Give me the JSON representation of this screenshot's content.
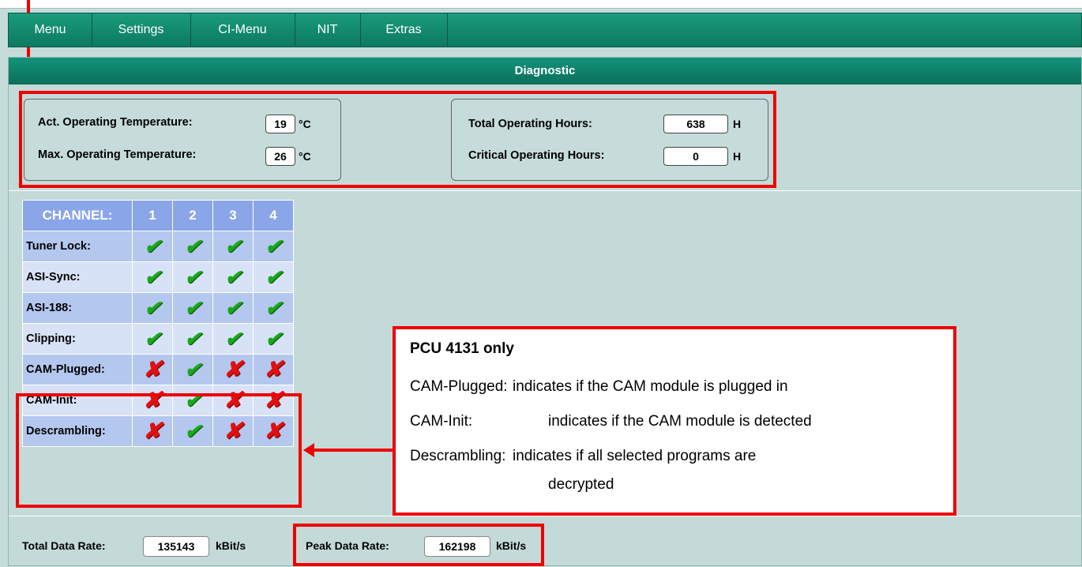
{
  "menu": {
    "items": [
      "Menu",
      "Settings",
      "CI-Menu",
      "NIT",
      "Extras"
    ]
  },
  "diagnostic": {
    "title": "Diagnostic",
    "act_temp_label": "Act. Operating Temperature:",
    "act_temp_value": "19",
    "max_temp_label": "Max. Operating Temperature:",
    "max_temp_value": "26",
    "temp_unit": "°C",
    "total_hours_label": "Total Operating Hours:",
    "total_hours_value": "638",
    "critical_hours_label": "Critical Operating Hours:",
    "critical_hours_value": "0",
    "hours_unit": "H"
  },
  "channel_table": {
    "header_label": "CHANNEL:",
    "channels": [
      "1",
      "2",
      "3",
      "4"
    ],
    "rows": [
      {
        "label": "Tuner Lock:",
        "status": [
          "ok",
          "ok",
          "ok",
          "ok"
        ]
      },
      {
        "label": "ASI-Sync:",
        "status": [
          "ok",
          "ok",
          "ok",
          "ok"
        ]
      },
      {
        "label": "ASI-188:",
        "status": [
          "ok",
          "ok",
          "ok",
          "ok"
        ]
      },
      {
        "label": "Clipping:",
        "status": [
          "ok",
          "ok",
          "ok",
          "ok"
        ]
      },
      {
        "label": "CAM-Plugged:",
        "status": [
          "fail",
          "ok",
          "fail",
          "fail"
        ]
      },
      {
        "label": "CAM-Init:",
        "status": [
          "fail",
          "ok",
          "fail",
          "fail"
        ]
      },
      {
        "label": "Descrambling:",
        "status": [
          "fail",
          "ok",
          "fail",
          "fail"
        ]
      }
    ],
    "ok_icon": "check-icon",
    "fail_icon": "cross-icon"
  },
  "callout": {
    "title": "PCU 4131 only",
    "line1_term": "CAM-Plugged:",
    "line1_desc": "indicates if the CAM module is plugged in",
    "line2_term": "CAM-Init:",
    "line2_desc": "indicates if the CAM module is detected",
    "line3_term": "Descrambling:",
    "line3_desc": "indicates if all selected programs are",
    "line3_cont": "decrypted"
  },
  "data_rate": {
    "total_label": "Total Data Rate:",
    "total_value": "135143",
    "peak_label": "Peak Data Rate:",
    "peak_value": "162198",
    "unit": "kBit/s"
  },
  "colors": {
    "highlight": "#ee0000",
    "menu_bar": "#0f8a6c",
    "ok": "#18a818",
    "fail": "#e01010"
  }
}
